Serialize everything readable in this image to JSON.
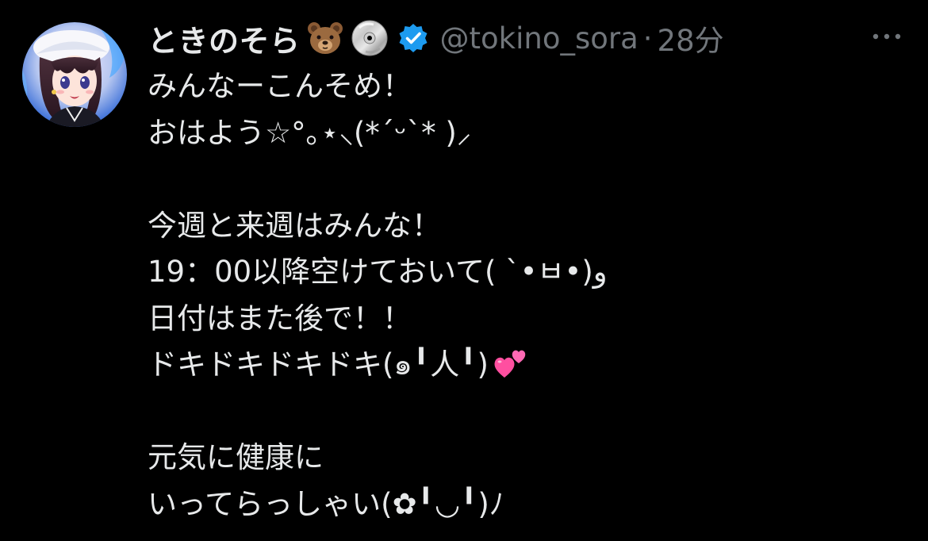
{
  "tweet": {
    "display_name": "ときのそら",
    "name_emojis": [
      "bear-emoji",
      "dvd-emoji"
    ],
    "verified": true,
    "handle": "@tokino_sora",
    "separator": "·",
    "time": "28分",
    "lines": [
      "みんなーこんそめ！",
      "おはよう☆°｡⋆⸜(*ˊᵕˋ* )⸝",
      "",
      "今週と来週はみんな！",
      "19：00以降空けておいて( ˋ•ㅂ•)و",
      "日付はまた後で！！",
      "ドキドキドキドキ(๑╹人╹)",
      "",
      "元気に健康に",
      "いってらっしゃい(✿╹◡╹)ﾉ"
    ],
    "trailing_emoji": "two-hearts-emoji"
  },
  "colors": {
    "background": "#000000",
    "text": "#e7e9ea",
    "secondary_text": "#71767b",
    "verified_badge": "#1d9bf0"
  }
}
